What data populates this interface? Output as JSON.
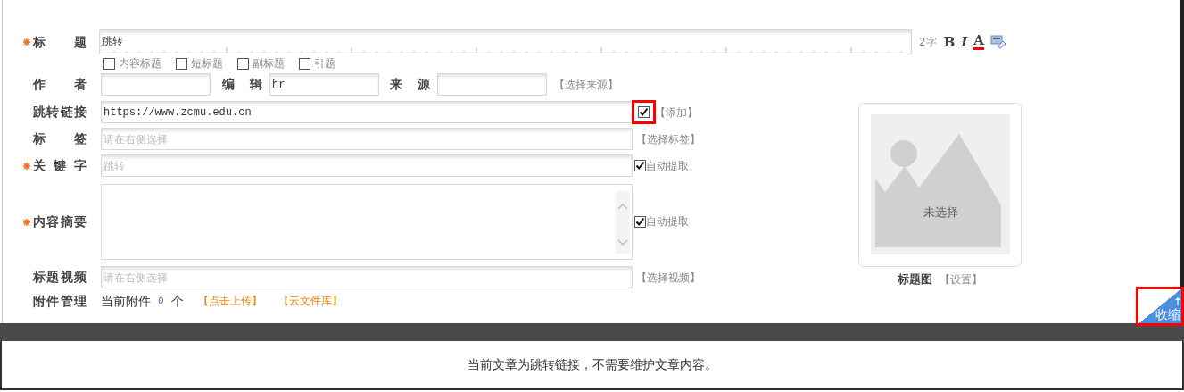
{
  "title_field": {
    "label": "标题",
    "required": true,
    "value": "跳转",
    "word_count": "2字"
  },
  "format_tools": [
    {
      "kind": "bold",
      "label": "B"
    },
    {
      "kind": "italic",
      "label": "I"
    },
    {
      "kind": "color",
      "label": "A",
      "color": "#ff0000"
    },
    {
      "kind": "spell"
    }
  ],
  "title_options": [
    {
      "label": "内容标题",
      "checked": false
    },
    {
      "label": "短标题",
      "checked": false
    },
    {
      "label": "副标题",
      "checked": false
    },
    {
      "label": "引题",
      "checked": false
    }
  ],
  "author": {
    "label": "作者"
  },
  "editor": {
    "label": "编辑",
    "value": "hr"
  },
  "source": {
    "label": "来源",
    "link": "【选择来源】"
  },
  "jump_link": {
    "label": "跳转链接",
    "value": "https://www.zcmu.edu.cn",
    "checked": true,
    "highlighted": true,
    "link": "【添加】"
  },
  "tags": {
    "label": "标签",
    "placeholder": "请在右侧选择",
    "link": "【选择标签】"
  },
  "keywords": {
    "label": "关键字",
    "required": true,
    "placeholder": "跳转",
    "checked": true,
    "check_label": "自动提取"
  },
  "summary": {
    "label": "内容摘要",
    "required": true,
    "checked": true,
    "check_label": "自动提取"
  },
  "video": {
    "label": "标题视频",
    "placeholder": "请在右侧选择",
    "link": "【选择视频】"
  },
  "attachments": {
    "label": "附件管理",
    "prefix": "当前附件",
    "count": "0",
    "suffix": "个",
    "links": [
      "【点击上传】",
      "【云文件库】"
    ]
  },
  "title_image": {
    "status": "未选择",
    "label": "标题图",
    "link": "【设置】"
  },
  "collapse_button": {
    "label": "收缩",
    "highlighted": true
  },
  "notice": "当前文章为跳转链接，不需要维护文章内容。"
}
